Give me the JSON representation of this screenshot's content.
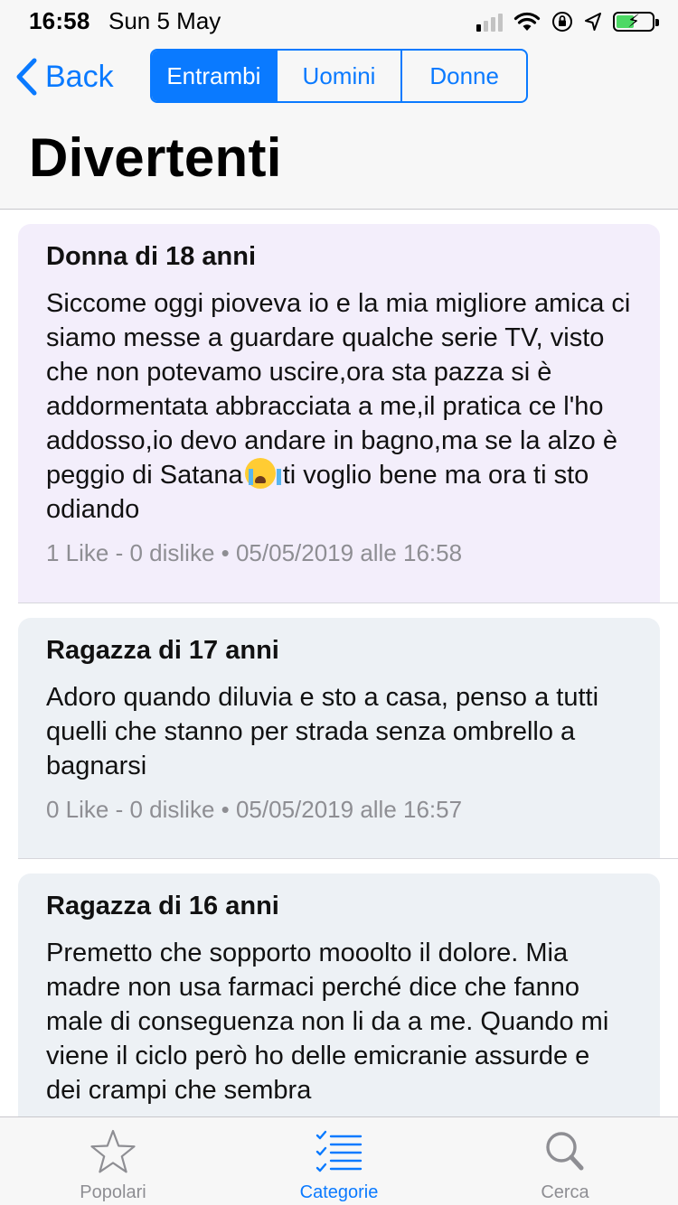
{
  "status": {
    "time": "16:58",
    "date": "Sun 5 May"
  },
  "nav": {
    "back_label": "Back",
    "segments": [
      "Entrambi",
      "Uomini",
      "Donne"
    ],
    "selected_segment": "Entrambi",
    "title": "Divertenti"
  },
  "posts": [
    {
      "author": "Donna di 18 anni",
      "text": "Siccome oggi pioveva io e la mia migliore amica ci siamo messe a guardare qualche serie TV, visto che non potevamo uscire,ora sta pazza si è addormentata abbracciata a me,il pratica ce l'ho addosso,io devo andare in bagno,ma se la alzo è peggio di Satana",
      "text_after_emoji": "ti voglio bene ma ora ti sto odiando",
      "meta": "1 Like - 0 dislike • 05/05/2019 alle 16:58"
    },
    {
      "author": "Ragazza di 17 anni",
      "text": "Adoro quando diluvia e sto a casa, penso a tutti quelli che stanno per strada senza ombrello a bagnarsi",
      "meta": "0 Like - 0 dislike • 05/05/2019 alle 16:57"
    },
    {
      "author": "Ragazza di 16 anni",
      "text": "Premetto che sopporto mooolto il dolore. Mia madre non usa farmaci perché dice che fanno male di conseguenza non li da a me. Quando mi viene il ciclo però ho delle emicranie assurde e dei crampi che sembra"
    }
  ],
  "tabs": [
    {
      "label": "Popolari",
      "icon": "star-icon",
      "active": false
    },
    {
      "label": "Categorie",
      "icon": "checklist-icon",
      "active": true
    },
    {
      "label": "Cerca",
      "icon": "search-icon",
      "active": false
    }
  ],
  "colors": {
    "accent": "#0a7aff",
    "card_pink": "#f3eefb",
    "card_blue": "#edf1f5",
    "meta_gray": "#8e8e93",
    "battery_green": "#4cd964"
  },
  "battery_level": 0.55
}
